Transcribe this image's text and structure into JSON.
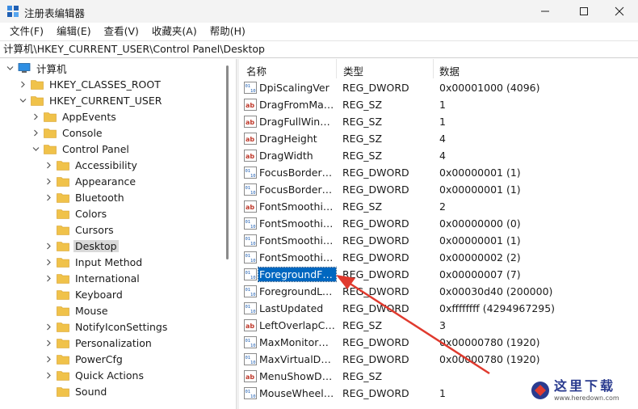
{
  "window": {
    "title": "注册表编辑器",
    "minimize_icon": "minimize-icon",
    "maximize_icon": "maximize-icon",
    "close_icon": "close-icon"
  },
  "menu": {
    "items": [
      "文件(F)",
      "编辑(E)",
      "查看(V)",
      "收藏夹(A)",
      "帮助(H)"
    ]
  },
  "address": {
    "path": "计算机\\HKEY_CURRENT_USER\\Control Panel\\Desktop"
  },
  "tree": {
    "items": [
      {
        "label": "计算机",
        "level": 0,
        "expanded": true,
        "icon": "computer-icon"
      },
      {
        "label": "HKEY_CLASSES_ROOT",
        "level": 1,
        "expanded": false
      },
      {
        "label": "HKEY_CURRENT_USER",
        "level": 1,
        "expanded": true
      },
      {
        "label": "AppEvents",
        "level": 2,
        "expanded": false
      },
      {
        "label": "Console",
        "level": 2,
        "expanded": false
      },
      {
        "label": "Control Panel",
        "level": 2,
        "expanded": true
      },
      {
        "label": "Accessibility",
        "level": 3,
        "expanded": false
      },
      {
        "label": "Appearance",
        "level": 3,
        "expanded": false
      },
      {
        "label": "Bluetooth",
        "level": 3,
        "expanded": false
      },
      {
        "label": "Colors",
        "level": 3,
        "leaf": true
      },
      {
        "label": "Cursors",
        "level": 3,
        "leaf": true
      },
      {
        "label": "Desktop",
        "level": 3,
        "expanded": false,
        "selected": true
      },
      {
        "label": "Input Method",
        "level": 3,
        "expanded": false
      },
      {
        "label": "International",
        "level": 3,
        "expanded": false
      },
      {
        "label": "Keyboard",
        "level": 3,
        "leaf": true
      },
      {
        "label": "Mouse",
        "level": 3,
        "leaf": true
      },
      {
        "label": "NotifyIconSettings",
        "level": 3,
        "expanded": false
      },
      {
        "label": "Personalization",
        "level": 3,
        "expanded": false
      },
      {
        "label": "PowerCfg",
        "level": 3,
        "expanded": false
      },
      {
        "label": "Quick Actions",
        "level": 3,
        "expanded": false
      },
      {
        "label": "Sound",
        "level": 3,
        "leaf": true
      }
    ]
  },
  "list": {
    "headers": {
      "name": "名称",
      "type": "类型",
      "data": "数据"
    },
    "rows": [
      {
        "name": "DpiScalingVer",
        "type": "REG_DWORD",
        "data": "0x00001000 (4096)",
        "icon": "dword-icon"
      },
      {
        "name": "DragFromMaxi...",
        "type": "REG_SZ",
        "data": "1",
        "icon": "string-icon"
      },
      {
        "name": "DragFullWindo...",
        "type": "REG_SZ",
        "data": "1",
        "icon": "string-icon"
      },
      {
        "name": "DragHeight",
        "type": "REG_SZ",
        "data": "4",
        "icon": "string-icon"
      },
      {
        "name": "DragWidth",
        "type": "REG_SZ",
        "data": "4",
        "icon": "string-icon"
      },
      {
        "name": "FocusBorderH...",
        "type": "REG_DWORD",
        "data": "0x00000001 (1)",
        "icon": "dword-icon"
      },
      {
        "name": "FocusBorderW...",
        "type": "REG_DWORD",
        "data": "0x00000001 (1)",
        "icon": "dword-icon"
      },
      {
        "name": "FontSmoothing",
        "type": "REG_SZ",
        "data": "2",
        "icon": "string-icon"
      },
      {
        "name": "FontSmoothin...",
        "type": "REG_DWORD",
        "data": "0x00000000 (0)",
        "icon": "dword-icon"
      },
      {
        "name": "FontSmoothin...",
        "type": "REG_DWORD",
        "data": "0x00000001 (1)",
        "icon": "dword-icon"
      },
      {
        "name": "FontSmoothin...",
        "type": "REG_DWORD",
        "data": "0x00000002 (2)",
        "icon": "dword-icon"
      },
      {
        "name": "ForegroundFla...",
        "type": "REG_DWORD",
        "data": "0x00000007 (7)",
        "icon": "dword-icon",
        "selected": true
      },
      {
        "name": "ForegroundLo...",
        "type": "REG_DWORD",
        "data": "0x00030d40 (200000)",
        "icon": "dword-icon"
      },
      {
        "name": "LastUpdated",
        "type": "REG_DWORD",
        "data": "0xffffffff (4294967295)",
        "icon": "dword-icon"
      },
      {
        "name": "LeftOverlapCh...",
        "type": "REG_SZ",
        "data": "3",
        "icon": "string-icon"
      },
      {
        "name": "MaxMonitorDi...",
        "type": "REG_DWORD",
        "data": "0x00000780 (1920)",
        "icon": "dword-icon"
      },
      {
        "name": "MaxVirtualDes...",
        "type": "REG_DWORD",
        "data": "0x00000780 (1920)",
        "icon": "dword-icon"
      },
      {
        "name": "MenuShowDelay",
        "type": "REG_SZ",
        "data": "",
        "icon": "string-icon"
      },
      {
        "name": "MouseWheelR...",
        "type": "REG_DWORD",
        "data": "1",
        "icon": "dword-icon"
      }
    ]
  },
  "watermark": {
    "text": "这里下载",
    "url": "www.heredown.com"
  },
  "colors": {
    "selection": "#0067c0",
    "folder": "#f0c24a",
    "arrow": "#e03a2e"
  }
}
